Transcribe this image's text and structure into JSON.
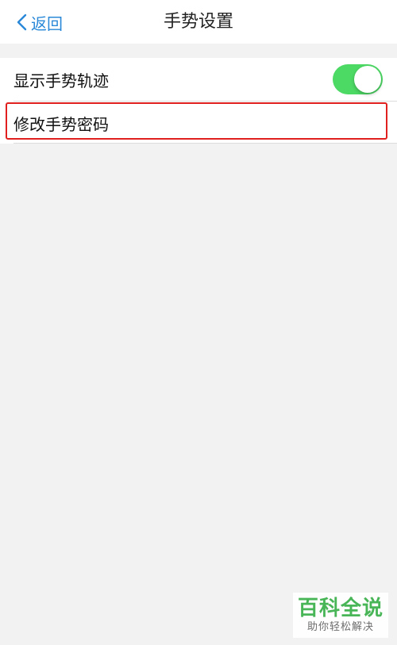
{
  "nav": {
    "back_label": "返回",
    "title": "手势设置"
  },
  "settings": {
    "show_track": {
      "label": "显示手势轨迹",
      "toggle_on": true,
      "toggle_color": "#4cd964"
    },
    "change_password": {
      "label": "修改手势密码"
    }
  },
  "highlight_color": "#e0201e",
  "watermark": {
    "title": "百科全说",
    "subtitle": "助你轻松解决"
  }
}
